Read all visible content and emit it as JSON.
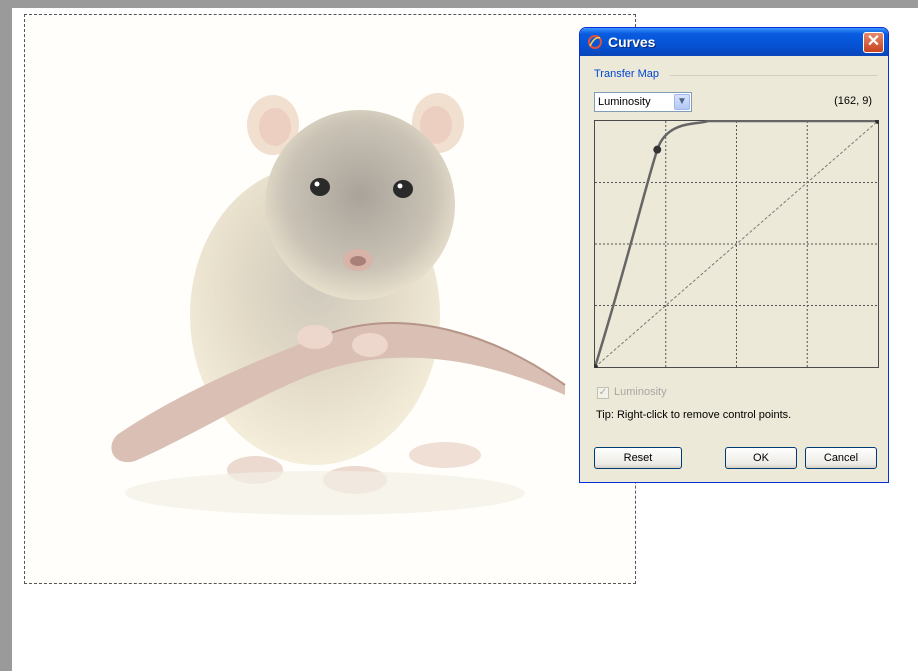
{
  "dialog": {
    "title": "Curves",
    "close_icon": "close-icon",
    "group_label": "Transfer Map",
    "channel": {
      "selected": "Luminosity",
      "options_visible": [
        "Luminosity"
      ]
    },
    "coordinates": "(162, 9)",
    "checkbox_label": "Luminosity",
    "checkbox_checked": true,
    "checkbox_enabled": false,
    "tip": "Tip: Right-click to remove control points.",
    "buttons": {
      "reset": "Reset",
      "ok": "OK",
      "cancel": "Cancel"
    }
  },
  "curve": {
    "grid_divisions": 4,
    "range": [
      0,
      255
    ],
    "control_points": [
      [
        0,
        0
      ],
      [
        162,
        9
      ],
      [
        255,
        255
      ]
    ]
  },
  "colors": {
    "titlebar": "#0552d6",
    "dialog_bg": "#ece9d8",
    "link_blue": "#0046d5",
    "curve": "#666666"
  }
}
